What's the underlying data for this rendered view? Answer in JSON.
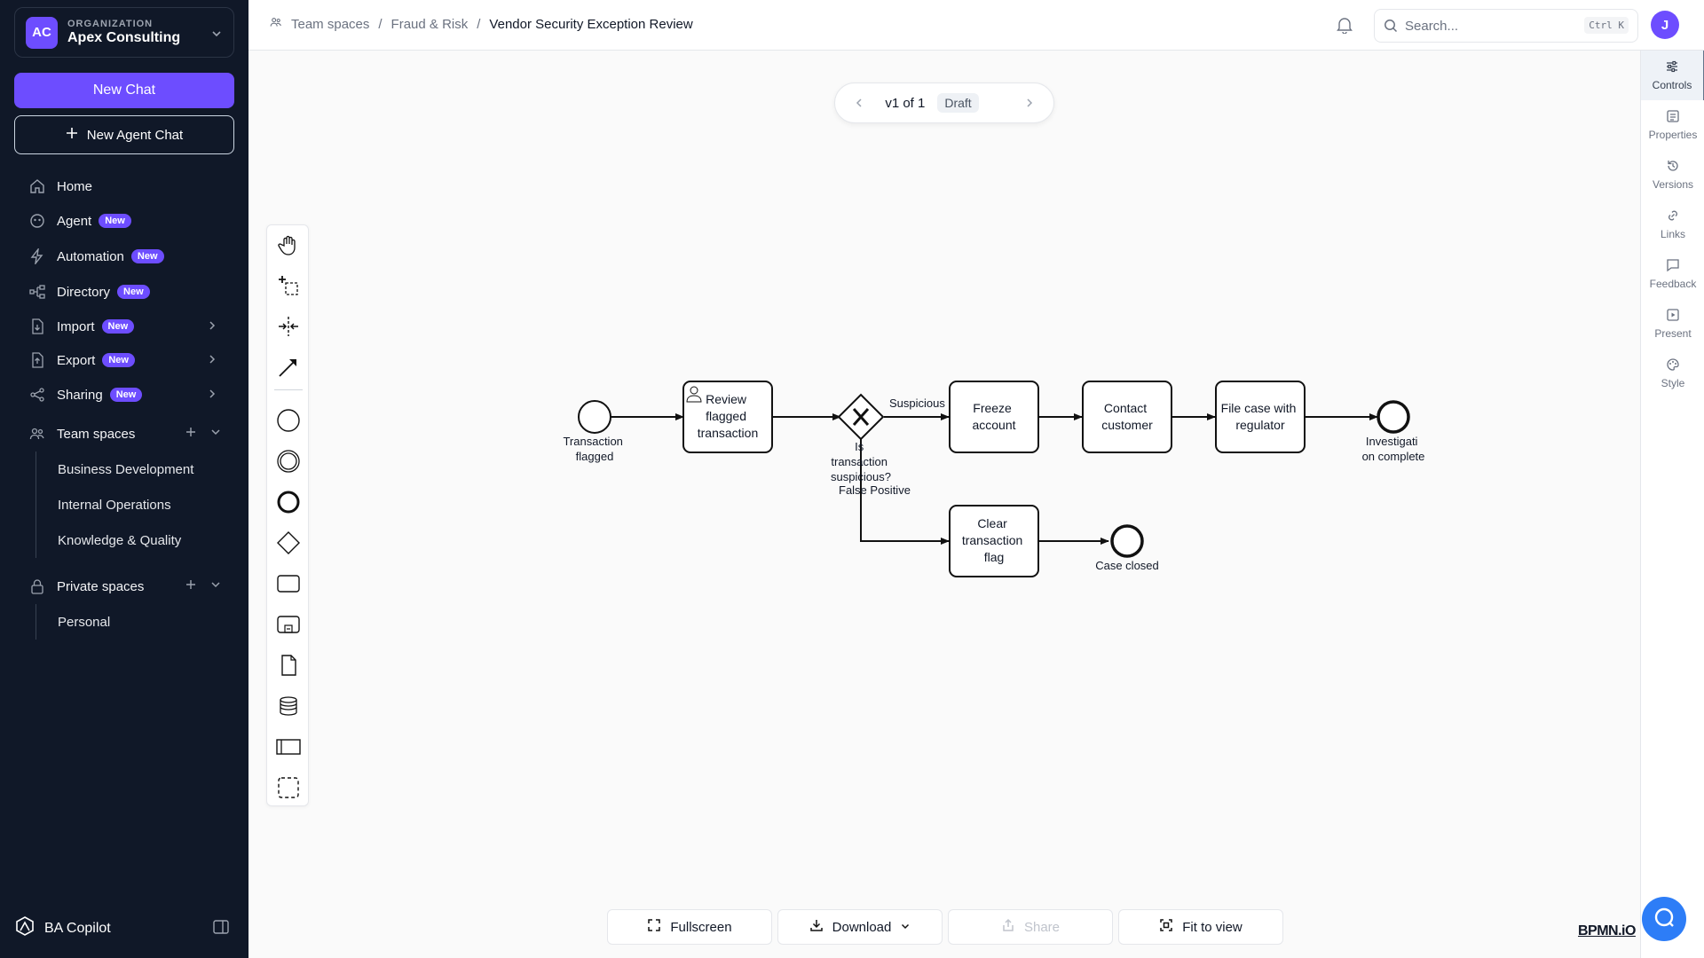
{
  "sidebar": {
    "org_caption": "ORGANIZATION",
    "org_name": "Apex Consulting",
    "org_initials": "AC",
    "new_chat": "New Chat",
    "new_agent_chat": "New Agent Chat",
    "nav": {
      "home": "Home",
      "agent": "Agent",
      "automation": "Automation",
      "directory": "Directory",
      "import": "Import",
      "export": "Export",
      "sharing": "Sharing"
    },
    "badge_new": "New",
    "team_spaces": "Team spaces",
    "team_items": [
      "Business Development",
      "Internal Operations",
      "Knowledge & Quality"
    ],
    "private_spaces": "Private spaces",
    "private_items": [
      "Personal"
    ],
    "brand": "BA Copilot"
  },
  "topbar": {
    "breadcrumb": [
      "Team spaces",
      "Fraud & Risk",
      "Vendor Security Exception Review"
    ],
    "search_placeholder": "Search...",
    "search_shortcut": "Ctrl K",
    "user_initial": "J"
  },
  "version": {
    "label": "v1 of 1",
    "status": "Draft"
  },
  "right_panel": [
    "Controls",
    "Properties",
    "Versions",
    "Links",
    "Feedback",
    "Present",
    "Style"
  ],
  "diagram": {
    "start_event": [
      "Transaction",
      "flagged"
    ],
    "task_review": [
      "Review",
      "flagged",
      "transaction"
    ],
    "gateway_label": [
      "Is",
      "transaction",
      "suspicious?"
    ],
    "flow_suspicious": "Suspicious",
    "flow_false_positive": "False Positive",
    "task_freeze": [
      "Freeze",
      "account"
    ],
    "task_contact": [
      "Contact",
      "customer"
    ],
    "task_file": [
      "File case with",
      "regulator"
    ],
    "end_investigation": [
      "Investigati",
      "on complete"
    ],
    "task_clear": [
      "Clear",
      "transaction",
      "flag"
    ],
    "end_closed": "Case closed"
  },
  "bottom": {
    "fullscreen": "Fullscreen",
    "download": "Download",
    "share": "Share",
    "fit": "Fit to view"
  },
  "logo_text": "BPMN.iO",
  "colors": {
    "accent": "#6d4dff",
    "sidebar_bg": "#101828",
    "fab": "#2d7df7"
  }
}
